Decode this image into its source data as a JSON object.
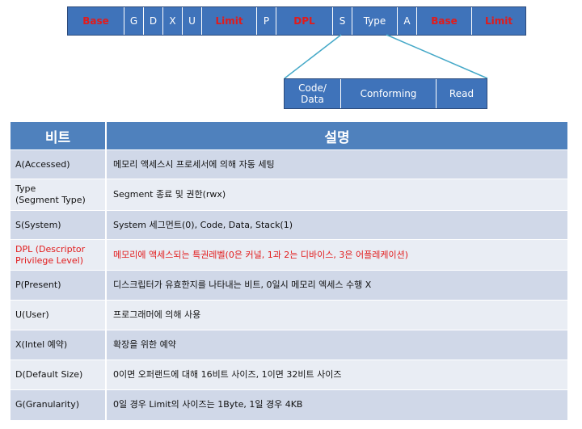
{
  "descriptor": {
    "fields": [
      {
        "label": "Base",
        "highlight": true
      },
      {
        "label": "G",
        "highlight": false
      },
      {
        "label": "D",
        "highlight": false
      },
      {
        "label": "X",
        "highlight": false
      },
      {
        "label": "U",
        "highlight": false
      },
      {
        "label": "Limit",
        "highlight": true
      },
      {
        "label": "P",
        "highlight": false
      },
      {
        "label": "DPL",
        "highlight": true
      },
      {
        "label": "S",
        "highlight": false
      },
      {
        "label": "Type",
        "highlight": false
      },
      {
        "label": "A",
        "highlight": false
      },
      {
        "label": "Base",
        "highlight": true
      },
      {
        "label": "Limit",
        "highlight": true
      }
    ],
    "type_detail": [
      "Code/\nData",
      "Conforming",
      "Read"
    ]
  },
  "table": {
    "headers": [
      "비트",
      "설명"
    ],
    "rows": [
      {
        "bit": "A(Accessed)",
        "desc": "메모리 액세스시 프로세서에 의해 자동 세팅",
        "highlight": false
      },
      {
        "bit": "Type\n(Segment Type)",
        "desc": "Segment 종료 및 권한(rwx)",
        "highlight": false
      },
      {
        "bit": "S(System)",
        "desc": "System 세그먼트(0), Code, Data, Stack(1)",
        "highlight": false
      },
      {
        "bit": "DPL (Descriptor\nPrivilege Level)",
        "desc": "메모리에 액세스되는 특권레벨(0은 커널, 1과 2는 디바이스, 3은 어플레케이션)",
        "highlight": true
      },
      {
        "bit": "P(Present)",
        "desc": "디스크립터가 유효한지를 나타내는 비트, 0일시 메모리 엑세스 수행 X",
        "highlight": false
      },
      {
        "bit": "U(User)",
        "desc": "프로그래머에 의해 사용",
        "highlight": false
      },
      {
        "bit": "X(Intel 예약)",
        "desc": "확장을 위한 예약",
        "highlight": false
      },
      {
        "bit": "D(Default Size)",
        "desc": "0이면 오퍼랜드에 대해 16비트 사이즈, 1이면 32비트 사이즈",
        "highlight": false
      },
      {
        "bit": "G(Granularity)",
        "desc": "0일 경우 Limit의 사이즈는 1Byte, 1일 경우 4KB",
        "highlight": false
      }
    ]
  },
  "colors": {
    "bar_fill": "#3f73ba",
    "header_fill": "#4f81bd",
    "row_odd": "#d0d8e8",
    "row_even": "#e9edf4",
    "highlight_text": "#e21b1b"
  }
}
